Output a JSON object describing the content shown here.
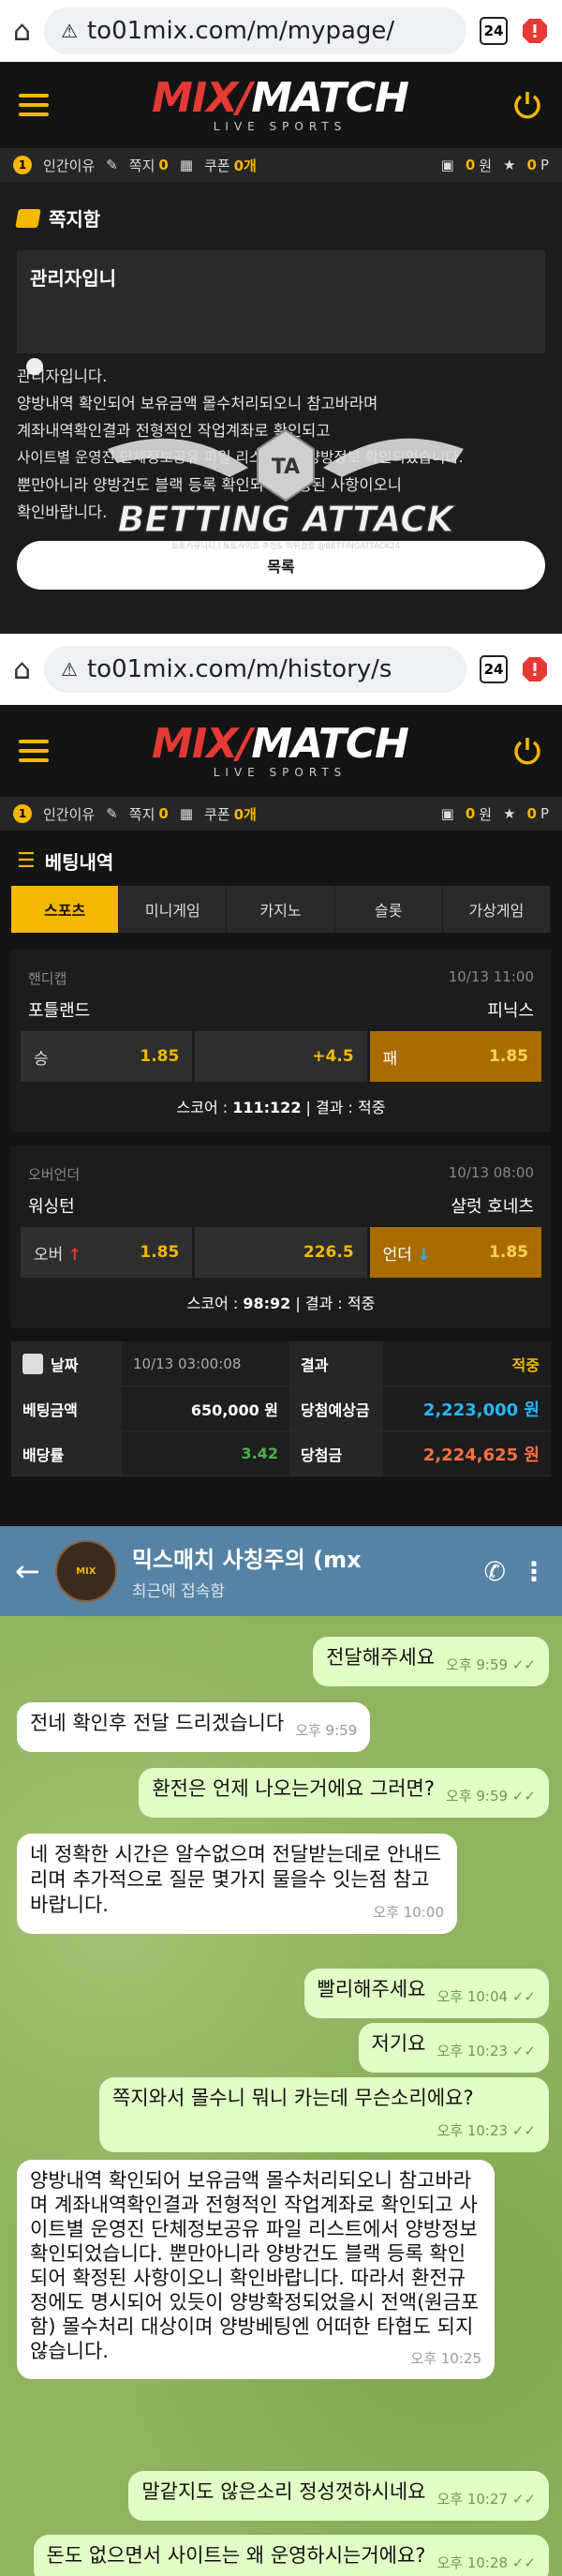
{
  "screen1": {
    "url": "to01mix.com/m/mypage/",
    "tab_count": "24",
    "logo": {
      "mix": "MIX",
      "match": "MATCH",
      "sub": "LIVE SPORTS"
    },
    "status": {
      "level": "1",
      "user": "인간이유",
      "notes_label": "쪽지",
      "notes": "0",
      "coupon_label": "쿠폰",
      "coupon": "0개",
      "money": "0",
      "money_unit": "원",
      "points": "0",
      "points_unit": "P"
    },
    "section_title": "쪽지함",
    "sender_partial": "관리자입니",
    "message_lines": [
      "관리자입니다.",
      "양방내역 확인되어 보유금액 몰수처리되오니 참고바라며",
      "계좌내역확인결과 전형적인 작업계좌로 확인되고",
      "사이트별 운영진 단체정보공유 파일 리스트에서 양방정보 확인되었습니다.",
      "뿐만아니라 양방건도 블랙 등록 확인되어 확정된 사항이오니",
      "확인바랍니다."
    ],
    "list_button": "목록"
  },
  "watermark": {
    "badge": "TA",
    "name": "BETTING ATTACK",
    "small": "토토커뮤니티 | 토토사이트 추천& 먹튀검증 @BETTINGATTACK24"
  },
  "screen2": {
    "url": "to01mix.com/m/history/s",
    "tab_count": "24",
    "status": {
      "level": "1",
      "user": "인간이유",
      "notes_label": "쪽지",
      "notes": "0",
      "coupon_label": "쿠폰",
      "coupon": "0개",
      "money": "0",
      "money_unit": "원",
      "points": "0",
      "points_unit": "P"
    },
    "section_title": "베팅내역",
    "tabs": [
      "스포츠",
      "미니게임",
      "카지노",
      "슬롯",
      "가상게임"
    ],
    "bets": [
      {
        "market": "핸디캡",
        "time": "10/13 11:00",
        "home": "포틀랜드",
        "away": "피닉스",
        "left_label": "승",
        "left_odds": "1.85",
        "mid": "+4.5",
        "right_label": "패",
        "right_odds": "1.85",
        "score_label": "스코어 :",
        "score": "111:122",
        "result_label": "결과 :",
        "result": "적중"
      },
      {
        "market": "오버언더",
        "time": "10/13 08:00",
        "home": "워싱턴",
        "away": "샬럿 호네츠",
        "left_label": "오버",
        "left_odds": "1.85",
        "mid": "226.5",
        "right_label": "언더",
        "right_odds": "1.85",
        "score_label": "스코어 :",
        "score": "98:92",
        "result_label": "결과 :",
        "result": "적중"
      }
    ],
    "summary": {
      "date_label": "날짜",
      "date": "10/13 03:00:08",
      "result_label": "결과",
      "result": "적중",
      "bet_label": "베팅금액",
      "bet": "650,000 원",
      "expected_label": "당첨예상금",
      "expected": "2,223,000 원",
      "odds_label": "배당률",
      "odds": "3.42",
      "win_label": "당첨금",
      "win": "2,224,625 원"
    },
    "colors": {
      "accent": "#f5b800",
      "blue": "#29b6f6",
      "orange": "#ff7043",
      "green": "#4caf50"
    }
  },
  "telegram": {
    "title": "믹스매치 사칭주의 (mx",
    "subtitle": "최근에 접속함",
    "messages": [
      {
        "dir": "out",
        "text": "전달해주세요",
        "time": "오후 9:59"
      },
      {
        "dir": "in",
        "text": "전네 확인후 전달 드리겠습니다",
        "time": "오후 9:59"
      },
      {
        "dir": "out",
        "text": "환전은 언제 나오는거에요 그러면?",
        "time": "오후 9:59"
      },
      {
        "dir": "in",
        "text": "네 정확한 시간은 알수없으며 전달받는데로 안내드리며 추가적으로 질문 몇가지 물을수 잇는점 참고바랍니다.",
        "time": "오후 10:00"
      },
      {
        "dir": "out",
        "text": "빨리해주세요",
        "time": "오후 10:04"
      },
      {
        "dir": "out",
        "text": "저기요",
        "time": "오후 10:23"
      },
      {
        "dir": "out",
        "text": "쪽지와서 몰수니 뭐니 카는데 무슨소리에요?",
        "time": "오후 10:23"
      },
      {
        "dir": "in",
        "text": "양방내역 확인되어 보유금액 몰수처리되오니 참고바라며 계좌내역확인결과 전형적인 작업계좌로 확인되고 사이트별 운영진 단체정보공유 파일 리스트에서 양방정보 확인되었습니다. 뿐만아니라 양방건도 블랙 등록 확인되어 확정된 사항이오니 확인바랍니다. 따라서 환전규정에도 명시되어 있듯이 양방확정되었을시 전액(원금포함) 몰수처리 대상이며 양방베팅엔 어떠한 타협도 되지않습니다.",
        "time": "오후 10:25"
      },
      {
        "dir": "out",
        "text": "말같지도 않은소리 정성껏하시네요",
        "time": "오후 10:27"
      },
      {
        "dir": "out",
        "text": "돈도 없으면서 사이트는 왜 운영하시는거에요?",
        "time": "오후 10:28"
      }
    ]
  }
}
